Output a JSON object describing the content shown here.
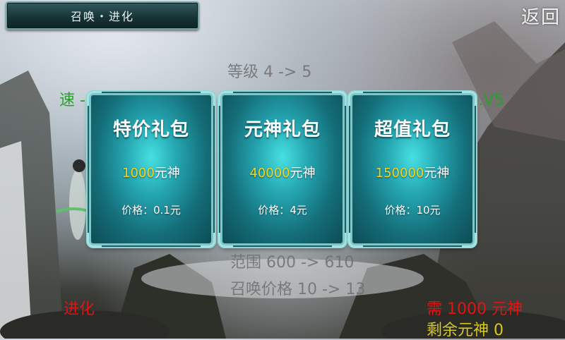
{
  "header": {
    "title": "召唤・进化",
    "back_label": "返回"
  },
  "background": {
    "level_line": "等级 4 -> 5",
    "speed_line": "速 -> 转 0.1/4",
    "right_line": "攻 -> 速 0.1/0.V5",
    "range_line": "范围 600 -> 610",
    "summon_price_line": "召唤价格 10 -> 13",
    "evolve_label": "进化",
    "need_line": "需 1000 元神",
    "remaining_line": "剩余元神 0"
  },
  "packages": [
    {
      "name": "特价礼包",
      "amount": "1000",
      "unit": "元神",
      "price": "价格：0.1元"
    },
    {
      "name": "元神礼包",
      "amount": "40000",
      "unit": "元神",
      "price": "价格：4元"
    },
    {
      "name": "超值礼包",
      "amount": "150000",
      "unit": "元神",
      "price": "价格：10元"
    }
  ],
  "colors": {
    "card_glow": "#47e0e2",
    "card_border": "#7ec6c8",
    "amount_highlight": "#f7d21b",
    "evolve_red": "#e01414",
    "stat_green": "#28a02a",
    "remaining_yellow": "#d8c81c"
  }
}
